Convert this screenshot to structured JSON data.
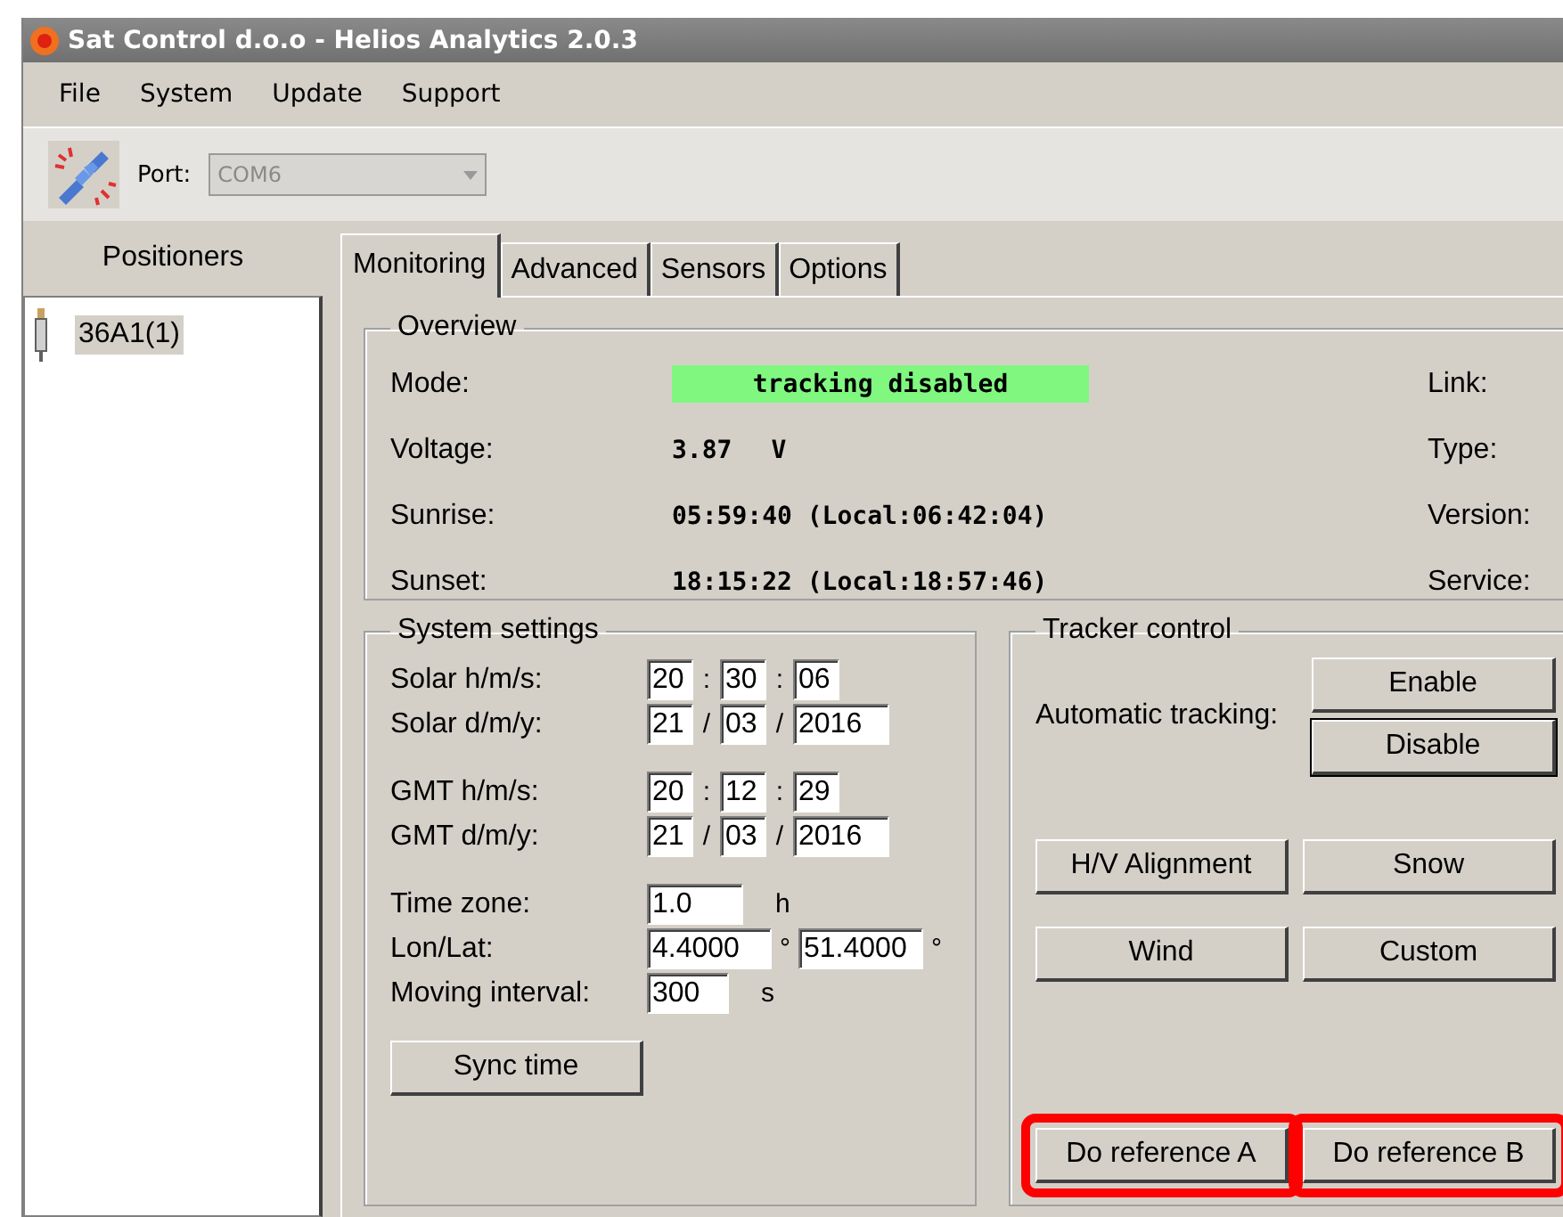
{
  "window": {
    "title": "Sat Control d.o.o - Helios Analytics 2.0.3"
  },
  "menu": [
    "File",
    "System",
    "Update",
    "Support"
  ],
  "toolbar": {
    "port_label": "Port:",
    "port_value": "COM6",
    "port_disabled": true
  },
  "positioners": {
    "title": "Positioners",
    "items": [
      {
        "label": "36A1(1)",
        "selected": true
      }
    ]
  },
  "tabs": [
    {
      "label": "Monitoring",
      "selected": true
    },
    {
      "label": "Advanced",
      "selected": false
    },
    {
      "label": "Sensors",
      "selected": false
    },
    {
      "label": "Options",
      "selected": false
    }
  ],
  "overview": {
    "title": "Overview",
    "rows": [
      {
        "label": "Mode:",
        "value": "tracking disabled",
        "color": "#80f880",
        "side_label": "Link:"
      },
      {
        "label": "Voltage:",
        "value": "3.87",
        "unit": "V",
        "side_label": "Type:"
      },
      {
        "label": "Sunrise:",
        "value": "05:59:40 (Local:06:42:04)",
        "side_label": "Version:"
      },
      {
        "label": "Sunset:",
        "value": "18:15:22 (Local:18:57:46)",
        "side_label": "Service:"
      }
    ]
  },
  "system_settings": {
    "title": "System settings",
    "groups": [
      {
        "rows": [
          {
            "label": "Solar h/m/s:",
            "parts": [
              {
                "kind": "field",
                "value": "20"
              },
              {
                "kind": "sep",
                "text": ":"
              },
              {
                "kind": "field",
                "value": "30"
              },
              {
                "kind": "sep",
                "text": ":"
              },
              {
                "kind": "field",
                "value": "06"
              }
            ]
          },
          {
            "label": "Solar d/m/y:",
            "parts": [
              {
                "kind": "field",
                "value": "21"
              },
              {
                "kind": "sep",
                "text": "/"
              },
              {
                "kind": "field",
                "value": "03"
              },
              {
                "kind": "sep",
                "text": "/"
              },
              {
                "kind": "wide",
                "value": "2016"
              }
            ]
          }
        ]
      },
      {
        "rows": [
          {
            "label": "GMT h/m/s:",
            "parts": [
              {
                "kind": "field",
                "value": "20"
              },
              {
                "kind": "sep",
                "text": ":"
              },
              {
                "kind": "field",
                "value": "12"
              },
              {
                "kind": "sep",
                "text": ":"
              },
              {
                "kind": "field",
                "value": "29"
              }
            ]
          },
          {
            "label": "GMT d/m/y:",
            "parts": [
              {
                "kind": "field",
                "value": "21"
              },
              {
                "kind": "sep",
                "text": "/"
              },
              {
                "kind": "field",
                "value": "03"
              },
              {
                "kind": "sep",
                "text": "/"
              },
              {
                "kind": "wide",
                "value": "2016"
              }
            ]
          }
        ]
      },
      {
        "rows": [
          {
            "label": "Time zone:",
            "parts": [
              {
                "kind": "wide",
                "value": "1.0"
              },
              {
                "kind": "unit",
                "text": "h"
              }
            ]
          },
          {
            "label": "Lon/Lat:",
            "parts": [
              {
                "kind": "long",
                "value": "4.4000"
              },
              {
                "kind": "sep",
                "text": "°"
              },
              {
                "kind": "long",
                "value": "51.4000"
              },
              {
                "kind": "sep",
                "text": "°"
              }
            ]
          },
          {
            "label": "Moving interval:",
            "parts": [
              {
                "kind": "mid",
                "value": "300"
              },
              {
                "kind": "unit",
                "text": "s"
              }
            ]
          }
        ]
      }
    ],
    "button": "Sync time"
  },
  "tracker_control": {
    "title": "Tracker control",
    "auto_label": "Automatic tracking:",
    "auto_buttons": [
      {
        "label": "Enable",
        "default": false
      },
      {
        "label": "Disable",
        "default": true
      }
    ],
    "buttons": [
      {
        "label": "H/V Alignment",
        "highlighted": false
      },
      {
        "label": "Snow",
        "highlighted": false
      },
      {
        "label": "Wind",
        "highlighted": false
      },
      {
        "label": "Custom",
        "highlighted": false
      }
    ],
    "reference_buttons": [
      {
        "label": "Do reference A",
        "highlighted": true
      },
      {
        "label": "Do reference B",
        "highlighted": true
      }
    ]
  }
}
